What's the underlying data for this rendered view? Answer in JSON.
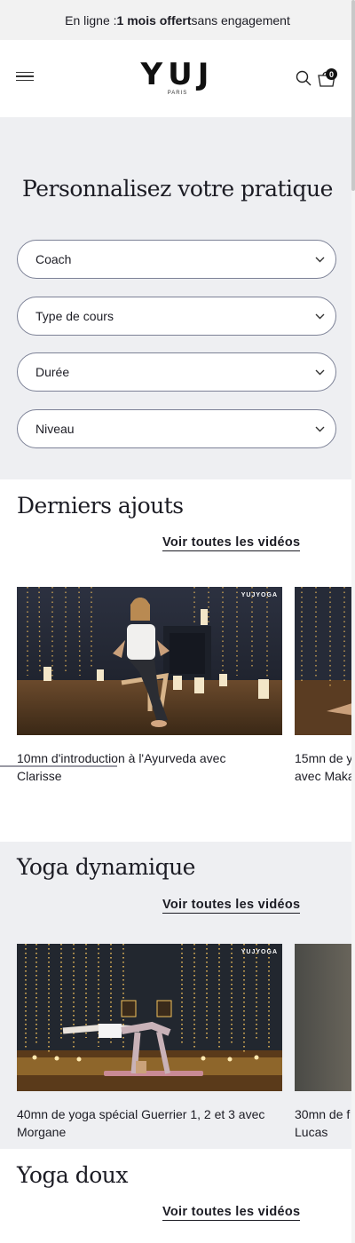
{
  "announcement": {
    "prefix": "En ligne : ",
    "highlight": "1 mois offert",
    "suffix": " sans engagement"
  },
  "header": {
    "logo_text": "YUJ",
    "logo_sub": "PARIS",
    "cart_count": "0"
  },
  "filters": {
    "title": "Personnalisez votre pratique",
    "selects": [
      {
        "label": "Coach"
      },
      {
        "label": "Type de cours"
      },
      {
        "label": "Durée"
      },
      {
        "label": "Niveau"
      }
    ]
  },
  "sections": [
    {
      "title": "Derniers ajouts",
      "see_all": "Voir toutes les vidéos",
      "cards": [
        {
          "title_line1": "10mn d'introduction à l'Ayurveda avec",
          "title_line2": "Clarisse",
          "watermark": "YUJYOGA"
        },
        {
          "title_line1": "15mn de y",
          "title_line2": "avec Maka"
        }
      ]
    },
    {
      "title": "Yoga dynamique",
      "see_all": "Voir toutes les vidéos",
      "cards": [
        {
          "title_line1": "40mn de yoga spécial Guerrier 1, 2 et 3 avec",
          "title_line2": "Morgane",
          "watermark": "YUJYOGA"
        },
        {
          "title_line1": "30mn de f",
          "title_line2": "Lucas"
        }
      ]
    },
    {
      "title": "Yoga doux",
      "see_all": "Voir toutes les vidéos"
    }
  ],
  "colors": {
    "accent": "#1c1c24",
    "section_bg": "#eeeff2",
    "border": "#7c8196"
  }
}
